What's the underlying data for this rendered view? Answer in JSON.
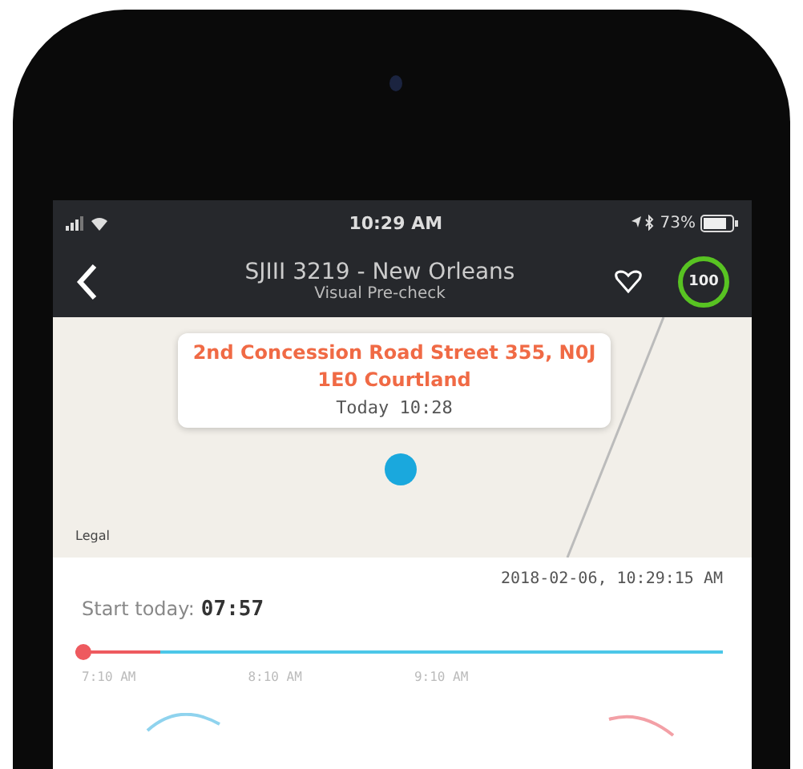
{
  "status_bar": {
    "time": "10:29 AM",
    "battery": "73%"
  },
  "nav_bar": {
    "title": "SJIII 3219 - New Orleans",
    "subtitle": "Visual Pre-check",
    "badge": "100"
  },
  "map": {
    "callout": {
      "address": "2nd Concession Road Street 355, N0J 1E0 Courtland",
      "time": "Today 10:28"
    },
    "legal": "Legal"
  },
  "summary": {
    "timestamp": "2018-02-06, 10:29:15 AM",
    "start_label": "Start today:",
    "start_time": "07:57"
  },
  "timeline": {
    "level": 0.13,
    "ticks": [
      "7:10 AM",
      "8:10 AM",
      "9:10 AM"
    ]
  }
}
